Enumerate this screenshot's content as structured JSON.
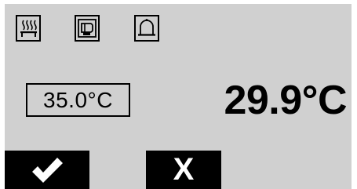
{
  "header": {
    "icons": [
      "heater-icon",
      "fan-icon",
      "bell-icon"
    ]
  },
  "temperature": {
    "setpoint": "35.0°C",
    "current": "29.9°C"
  },
  "actions": {
    "confirm_icon": "checkmark-icon",
    "cancel_label": "X"
  },
  "colors": {
    "background": "#d0d0d0",
    "foreground": "#000000",
    "button_text": "#ffffff"
  }
}
